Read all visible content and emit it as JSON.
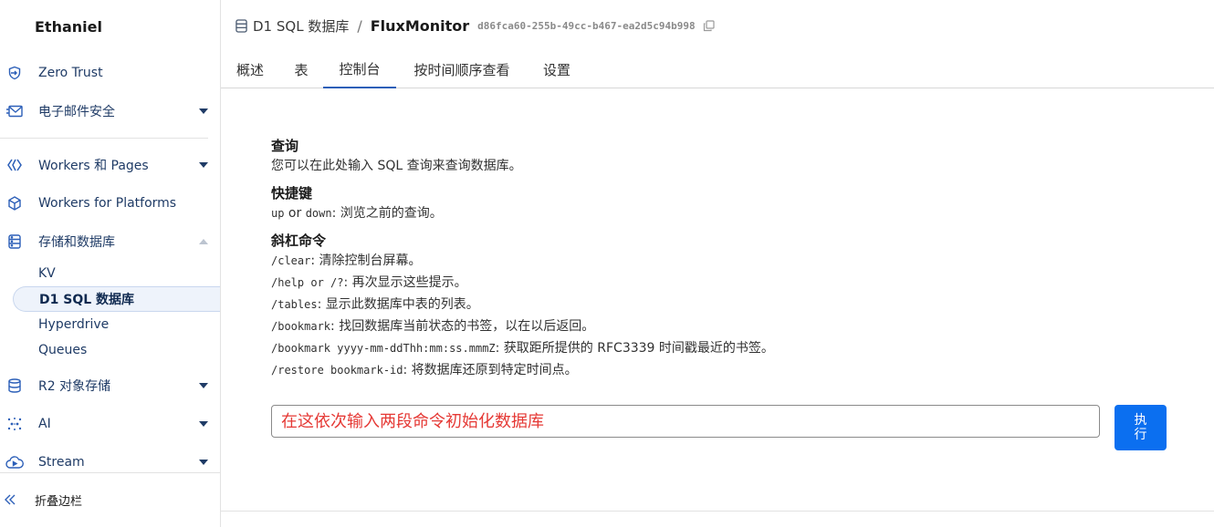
{
  "sidebar": {
    "account": "Ethaniel",
    "items": [
      {
        "label": "Zero Trust"
      },
      {
        "label": "电子邮件安全"
      },
      {
        "label": "Workers 和 Pages"
      },
      {
        "label": "Workers for Platforms"
      },
      {
        "label": "存储和数据库"
      },
      {
        "label": "R2 对象存储"
      },
      {
        "label": "AI"
      },
      {
        "label": "Stream"
      }
    ],
    "storage_sub": [
      {
        "label": "KV"
      },
      {
        "label": "D1 SQL 数据库"
      },
      {
        "label": "Hyperdrive"
      },
      {
        "label": "Queues"
      }
    ],
    "collapse_label": "折叠边栏"
  },
  "breadcrumb": {
    "parent": "D1 SQL 数据库",
    "separator": "/",
    "current": "FluxMonitor",
    "id": "d86fca60-255b-49cc-b467-ea2d5c94b998"
  },
  "tabs": [
    {
      "label": "概述"
    },
    {
      "label": "表"
    },
    {
      "label": "控制台"
    },
    {
      "label": "按时间顺序查看"
    },
    {
      "label": "设置"
    }
  ],
  "help": {
    "query_title": "查询",
    "query_desc": "您可以在此处输入 SQL 查询来查询数据库。",
    "shortcut_title": "快捷键",
    "shortcut_up": "up",
    "shortcut_or": " or ",
    "shortcut_down": "down",
    "shortcut_desc": ": 浏览之前的查询。",
    "slash_title": "斜杠命令",
    "commands": [
      {
        "cmd": "/clear",
        "desc": ": 清除控制台屏幕。"
      },
      {
        "cmd": "/help or /?",
        "desc": ": 再次显示这些提示。"
      },
      {
        "cmd": "/tables",
        "desc": ": 显示此数据库中表的列表。"
      },
      {
        "cmd": "/bookmark",
        "desc": ": 找回数据库当前状态的书签，以在以后返回。"
      },
      {
        "cmd": "/bookmark yyyy-mm-ddThh:mm:ss.mmmZ",
        "desc": ": 获取距所提供的 RFC3339 时间戳最近的书签。"
      },
      {
        "cmd": "/restore bookmark-id",
        "desc": ": 将数据库还原到特定时间点。"
      }
    ]
  },
  "console": {
    "placeholder": "在这依次输入两段命令初始化数据库",
    "run_label": "执行"
  },
  "colors": {
    "accent": "#0b6ff0",
    "input_text": "#e53935",
    "nav_text": "#1f3b66"
  }
}
